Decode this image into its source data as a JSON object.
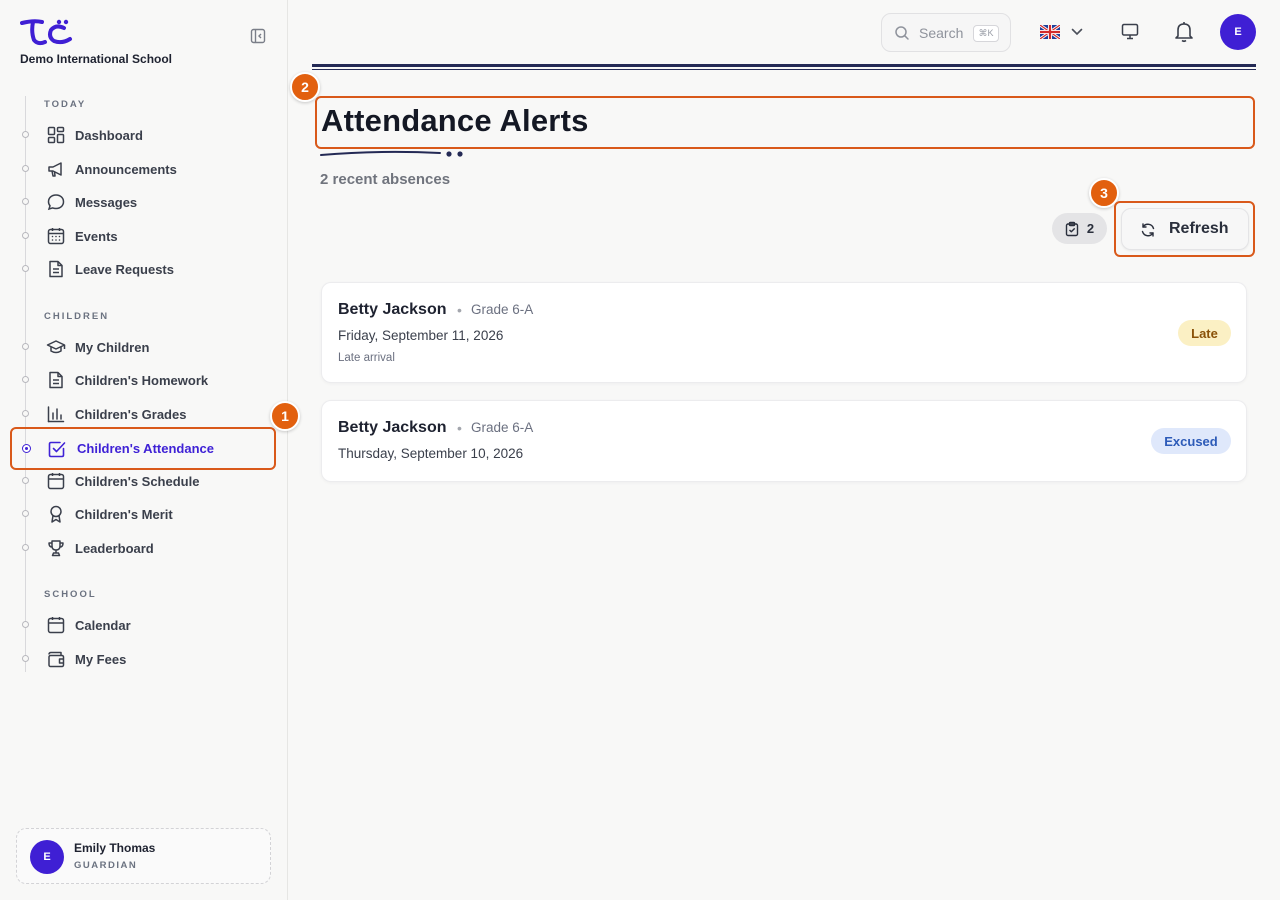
{
  "app": {
    "school_name": "Demo International School"
  },
  "sidebar": {
    "sections": [
      {
        "title": "TODAY"
      },
      {
        "title": "CHILDREN"
      },
      {
        "title": "SCHOOL"
      }
    ],
    "items": [
      {
        "label": "Dashboard",
        "icon": "dashboard-icon"
      },
      {
        "label": "Announcements",
        "icon": "megaphone-icon"
      },
      {
        "label": "Messages",
        "icon": "chat-bubble-icon"
      },
      {
        "label": "Events",
        "icon": "calendar-grid-icon"
      },
      {
        "label": "Leave Requests",
        "icon": "document-icon"
      },
      {
        "label": "My Children",
        "icon": "graduation-cap-icon"
      },
      {
        "label": "Children's Homework",
        "icon": "document-icon"
      },
      {
        "label": "Children's Grades",
        "icon": "bar-chart-icon"
      },
      {
        "label": "Children's Attendance",
        "icon": "checkbox-icon",
        "active": true
      },
      {
        "label": "Children's Schedule",
        "icon": "calendar-icon"
      },
      {
        "label": "Children's Merit",
        "icon": "award-icon"
      },
      {
        "label": "Leaderboard",
        "icon": "trophy-icon"
      },
      {
        "label": "Calendar",
        "icon": "calendar-icon"
      },
      {
        "label": "My Fees",
        "icon": "wallet-icon"
      }
    ],
    "user": {
      "initial": "E",
      "name": "Emily Thomas",
      "role": "GUARDIAN"
    }
  },
  "topbar": {
    "search_placeholder": "Search",
    "search_shortcut": "⌘K",
    "language": "en-GB",
    "avatar_initial": "E"
  },
  "markers": [
    "1",
    "2",
    "3"
  ],
  "main": {
    "title": "Attendance Alerts",
    "subtitle": "2 recent absences",
    "count": "2",
    "refresh_label": "Refresh",
    "alerts": [
      {
        "name": "Betty Jackson",
        "separator": "•",
        "grade": "Grade 6-A",
        "date": "Friday, September 11, 2026",
        "note": "Late arrival",
        "status": "Late"
      },
      {
        "name": "Betty Jackson",
        "separator": "•",
        "grade": "Grade 6-A",
        "date": "Thursday, September 10, 2026",
        "status": "Excused"
      }
    ]
  },
  "colors": {
    "brand": "#3f1fd4",
    "highlight": "#d9591a",
    "late_bg": "#fbf0c4",
    "excused_bg": "#dfe8fb"
  }
}
